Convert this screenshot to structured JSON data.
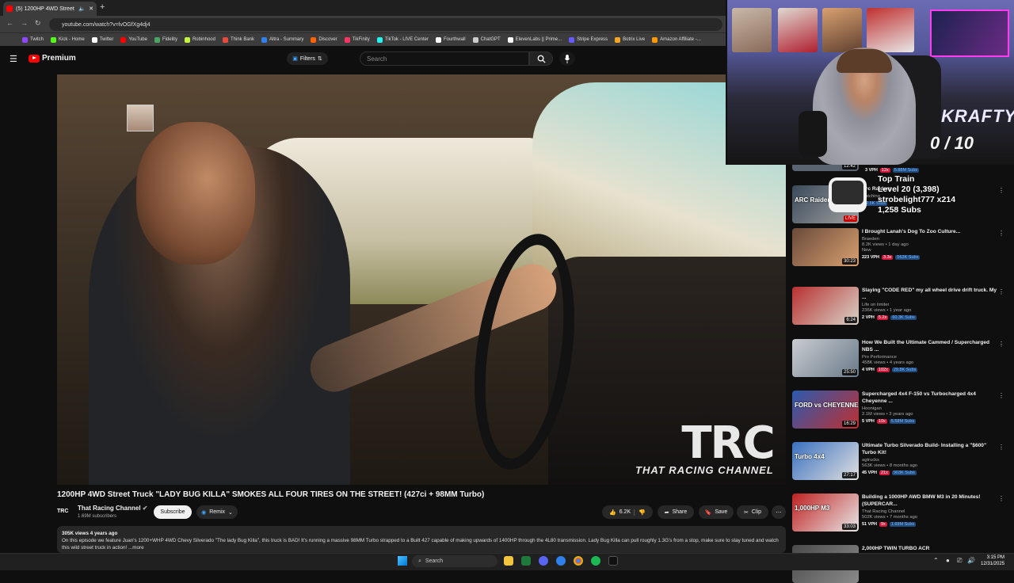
{
  "browser": {
    "tab_title": "(5) 1200HP 4WD Street Truck",
    "new_tab": "+",
    "url": "youtube.com/watch?v=lvOGfXg4dj4",
    "bookmarks": [
      {
        "label": "Twitch",
        "color": "#9146ff"
      },
      {
        "label": "Kick - Home",
        "color": "#53fc18"
      },
      {
        "label": "Twitter",
        "color": "#ffffff"
      },
      {
        "label": "YouTube",
        "color": "#ff0000"
      },
      {
        "label": "Fidelity",
        "color": "#4aa564"
      },
      {
        "label": "Robinhood",
        "color": "#c3f53c"
      },
      {
        "label": "Think Bank",
        "color": "#e84a3c"
      },
      {
        "label": "Altra - Summary",
        "color": "#2f80ed"
      },
      {
        "label": "Discover",
        "color": "#ff6000"
      },
      {
        "label": "TikFinity",
        "color": "#ff3366"
      },
      {
        "label": "TikTok - LIVE Center",
        "color": "#25f4ee"
      },
      {
        "label": "Fourthwall",
        "color": "#ffffff"
      },
      {
        "label": "ChatGPT",
        "color": "#cccccc"
      },
      {
        "label": "ElevenLabs || Prime...",
        "color": "#ffffff"
      },
      {
        "label": "Stripe Express",
        "color": "#635bff"
      },
      {
        "label": "Botrix Live",
        "color": "#f5a623"
      },
      {
        "label": "Amazon Affiliate -...",
        "color": "#ff9900"
      }
    ]
  },
  "youtube": {
    "logo_text": "Premium",
    "filters_label": "Filters",
    "search_placeholder": "Search"
  },
  "video": {
    "watermark_big": "TRC",
    "watermark_small": "THAT RACING CHANNEL",
    "title": "1200HP 4WD Street Truck \"LADY BUG KILLA\" SMOKES ALL FOUR TIRES ON THE STREET! (427ci + 98MM Turbo)",
    "channel": "That Racing Channel",
    "channel_logo": "TRC",
    "subscribers": "1.69M subscribers",
    "subscribe_label": "Subscribe",
    "remix_label": "Remix",
    "likes": "6.2K",
    "share_label": "Share",
    "save_label": "Save",
    "clip_label": "Clip",
    "more_label": "⋯",
    "desc_meta": "305K views  4 years ago",
    "description": "On this episode we feature Juan's 1200+WHP 4WD Chevy Silverado \"The lady Bug Killa\", this truck is BAD! It's running a massive 98MM Turbo strapped to a Built 427 capable of making upwards of 1400HP through the 4L80 transmission. Lady Bug Killa can pull roughly 1.3G's from a stop, make sure to stay tuned and watch this wild street truck in action! ...more"
  },
  "stream_overlay": {
    "counter": "0 / 10",
    "brand": "KRAFTY",
    "train_title": "Top Train",
    "train_level": "Level 20 (3,398)",
    "train_user": "strobelight777 x214",
    "train_subs": "1,258 Subs"
  },
  "sidebar": {
    "top_badges": {
      "vph": "3 VPH",
      "x": "12x",
      "subs": "5.88M Subs",
      "duration": "12:42"
    },
    "items": [
      {
        "title": "Arc Raiders",
        "channel": "",
        "views": "watching",
        "duration": "LIVE",
        "vph": "",
        "mult": "",
        "subs": "22.5K Subs",
        "thumb": "#3a4a5a",
        "thumb2": "#a0a0a0",
        "thumb_text": "ARC Raiders"
      },
      {
        "title": "I Brought Lanah's Dog To Zoo Culture...",
        "channel": "Braeden",
        "views": "8.2K views • 1 day ago",
        "extra": "New",
        "duration": "30:23",
        "vph": "223 VPH",
        "mult": "3.3x",
        "subs": "563K Subs",
        "thumb": "#6a4a3a",
        "thumb2": "#d8a070",
        "thumb_text": ""
      },
      {
        "title": "Slaying \"CODE RED\" my all wheel drive drift truck. My ...",
        "channel": "Life on limiter",
        "views": "236K views • 1 year ago",
        "duration": "6:24",
        "vph": "2 VPH",
        "mult": "5.2x",
        "subs": "60.3K Subs",
        "thumb": "#b83030",
        "thumb2": "#d8d4c8",
        "thumb_text": ""
      },
      {
        "title": "How We Built the Ultimate Cammed / Supercharged NBS ...",
        "channel": "Pro Performance",
        "views": "458K views • 4 years ago",
        "duration": "25:50",
        "vph": "4 VPH",
        "mult": "102x",
        "subs": "29.8K Subs",
        "thumb": "#c8ccd0",
        "thumb2": "#6a7a8a",
        "thumb_text": ""
      },
      {
        "title": "Supercharged 4x4 F-150 vs Turbocharged 4x4 Cheyenne ...",
        "channel": "Hoonigan",
        "views": "2.1M views • 3 years ago",
        "duration": "16:29",
        "vph": "5 VPH",
        "mult": "10x",
        "subs": "5.58M Subs",
        "thumb": "#2a5ab0",
        "thumb2": "#c03030",
        "thumb_text": "FORD vs CHEYENNE"
      },
      {
        "title": "Ultimate Turbo Silverado Build- Installing a \"$600\" Turbo Kit!",
        "channel": "agtrucks",
        "views": "563K views • 8 months ago",
        "duration": "27:17",
        "vph": "45 VPH",
        "mult": "21x",
        "subs": "903K Subs",
        "thumb": "#3a70c0",
        "thumb2": "#e0e0e0",
        "thumb_text": "Turbo 4x4"
      },
      {
        "title": "Building a 1000HP AWD BMW M3 in 20 Minutes! (SUPERCAR...",
        "channel": "That Racing Channel",
        "views": "502K views • 7 months ago",
        "duration": "33:03",
        "vph": "51 VPH",
        "mult": "9x",
        "subs": "1.69M Subs",
        "thumb": "#c02020",
        "thumb2": "#e8e8e8",
        "thumb_text": "1,000HP M3"
      },
      {
        "title": "2,000HP TWIN TURBO ACR",
        "channel": "",
        "views": "",
        "duration": "",
        "vph": "",
        "mult": "",
        "subs": "",
        "thumb": "#4a4a4a",
        "thumb2": "#8a8a8a",
        "thumb_text": ""
      }
    ]
  },
  "taskbar": {
    "search_label": "Search",
    "time": "3:15 PM",
    "date": "12/31/2025"
  }
}
